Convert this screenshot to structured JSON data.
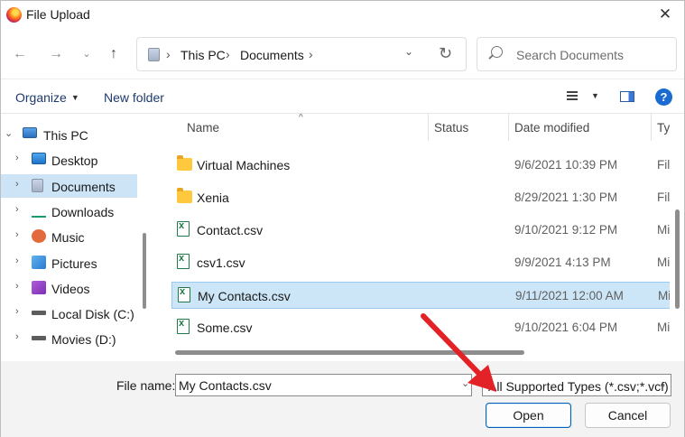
{
  "window": {
    "title": "File Upload",
    "close_glyph": "✕"
  },
  "address": {
    "crumbs": [
      "This PC",
      "Documents"
    ],
    "search_placeholder": "Search Documents"
  },
  "commands": {
    "organize": "Organize",
    "new_folder": "New folder"
  },
  "nav": {
    "items": [
      {
        "label": "This PC",
        "icon": "monitor-icon",
        "level": 0,
        "expanded": true
      },
      {
        "label": "Desktop",
        "icon": "desktop-icon",
        "level": 1
      },
      {
        "label": "Documents",
        "icon": "documents-icon",
        "level": 1,
        "selected": true
      },
      {
        "label": "Downloads",
        "icon": "download-icon",
        "level": 1
      },
      {
        "label": "Music",
        "icon": "music-icon",
        "level": 1
      },
      {
        "label": "Pictures",
        "icon": "pictures-icon",
        "level": 1
      },
      {
        "label": "Videos",
        "icon": "videos-icon",
        "level": 1
      },
      {
        "label": "Local Disk (C:)",
        "icon": "drive-icon",
        "level": 1
      },
      {
        "label": "Movies (D:)",
        "icon": "drive-icon",
        "level": 1
      }
    ]
  },
  "files": {
    "columns": {
      "name": "Name",
      "status": "Status",
      "date": "Date modified",
      "type": "Typ"
    },
    "rows": [
      {
        "name": "Virtual Machines",
        "date": "9/6/2021 10:39 PM",
        "type": "File",
        "kind": "folder"
      },
      {
        "name": "Xenia",
        "date": "8/29/2021 1:30 PM",
        "type": "File",
        "kind": "folder"
      },
      {
        "name": "Contact.csv",
        "date": "9/10/2021 9:12 PM",
        "type": "Mi",
        "kind": "csv"
      },
      {
        "name": "csv1.csv",
        "date": "9/9/2021 4:13 PM",
        "type": "Mi",
        "kind": "csv"
      },
      {
        "name": "My Contacts.csv",
        "date": "9/11/2021 12:00 AM",
        "type": "Mi",
        "kind": "csv",
        "selected": true
      },
      {
        "name": "Some.csv",
        "date": "9/10/2021 6:04 PM",
        "type": "Mi",
        "kind": "csv"
      }
    ]
  },
  "footer": {
    "file_name_label": "File name:",
    "file_name_value": "My Contacts.csv",
    "file_type": "All Supported Types (*.csv;*.vcf)",
    "open_label": "Open",
    "cancel_label": "Cancel"
  },
  "colors": {
    "accent": "#005fb8",
    "selection": "#cce5f7",
    "arrow": "#e32227"
  }
}
